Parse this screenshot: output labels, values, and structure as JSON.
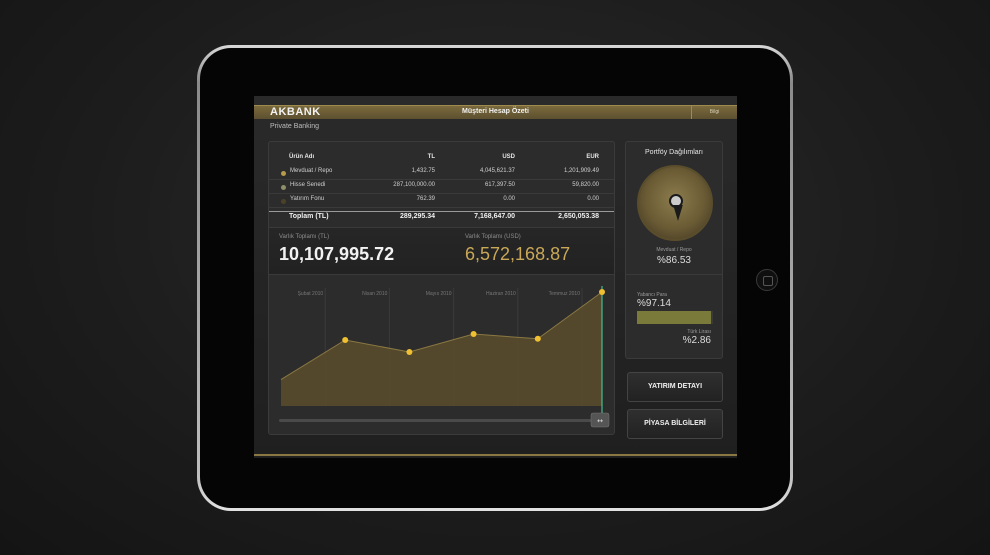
{
  "app": {
    "brand": "AKBANK",
    "subbrand": "Private Banking",
    "title": "Müşteri Hesap Özeti",
    "topbar_button": "Bilgi"
  },
  "table": {
    "headers": [
      "Ürün Adı",
      "TL",
      "USD",
      "EUR"
    ],
    "rows": [
      {
        "name": "Mevduat / Repo",
        "tl": "1,432.75",
        "usd": "4,045,621.37",
        "eur": "1,201,909.49",
        "color": "#b59b4a"
      },
      {
        "name": "Hisse Senedi",
        "tl": "287,100,000.00",
        "usd": "617,397.50",
        "eur": "59,820.00",
        "color": "#8e8e68"
      },
      {
        "name": "Yatırım Fonu",
        "tl": "762.39",
        "usd": "0.00",
        "eur": "0.00",
        "color": "#4a4326"
      }
    ],
    "total": {
      "label": "Toplam (TL)",
      "tl": "289,295.34",
      "usd": "7,168,647.00",
      "eur": "2,650,053.38"
    }
  },
  "totals": {
    "tl_label": "Varlık Toplamı (TL)",
    "tl_value": "10,107,995.72",
    "usd_label": "Varlık Toplamı (USD)",
    "usd_value": "6,572,168.87"
  },
  "chart_data": {
    "type": "area",
    "categories": [
      "Şubat 2010",
      "Nisan 2010",
      "Mayıs 2010",
      "Haziran 2010",
      "Temmuz 2010"
    ],
    "x": [
      0,
      1,
      2,
      3,
      4,
      5
    ],
    "values": [
      0.22,
      0.55,
      0.45,
      0.6,
      0.56,
      0.95
    ],
    "title": "",
    "xlabel": "",
    "ylabel": "",
    "ylim": [
      0,
      1
    ],
    "grid": true,
    "colors": {
      "fill": "#5a4e2c",
      "line": "#8a7843",
      "point": "#f0c030",
      "cursor": "#4ad9a0"
    }
  },
  "portfolio": {
    "title": "Portföy Dağılımları",
    "pie_label": "Mevduat / Repo",
    "pie_value": "%86.53",
    "foreign_label": "Yabancı Para",
    "foreign_value": "%97.14",
    "tl_label": "Türk Lirası",
    "tl_value": "%2.86",
    "bar_fraction": 0.971
  },
  "buttons": {
    "investment": "YATIRIM DETAYI",
    "market": "PİYASA BİLGİLERİ"
  }
}
